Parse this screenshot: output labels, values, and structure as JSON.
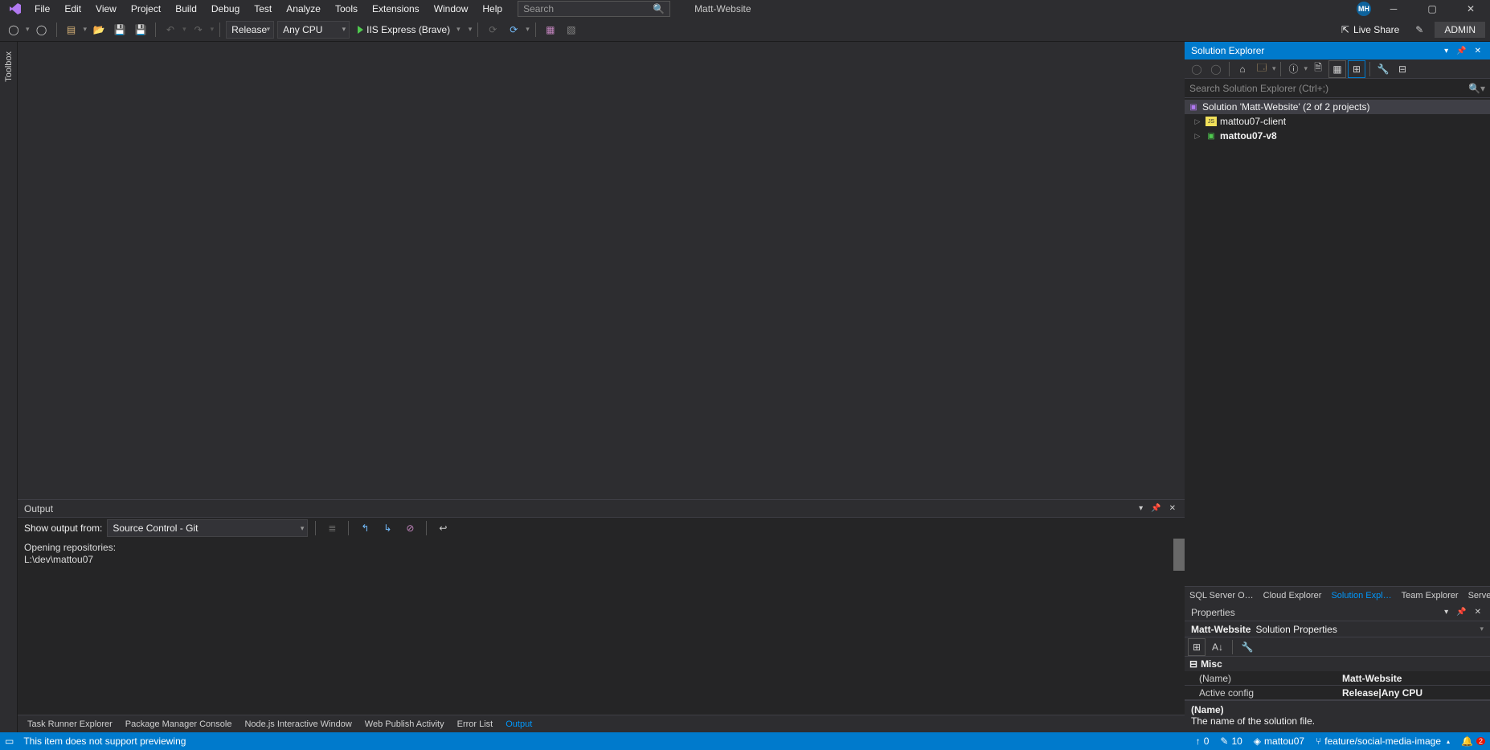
{
  "menu": [
    "File",
    "Edit",
    "View",
    "Project",
    "Build",
    "Debug",
    "Test",
    "Analyze",
    "Tools",
    "Extensions",
    "Window",
    "Help"
  ],
  "search_placeholder": "Search",
  "solution_name_title": "Matt-Website",
  "avatar_initials": "MH",
  "toolbar": {
    "config": "Release",
    "platform": "Any CPU",
    "run_target": "IIS Express (Brave)",
    "live_share": "Live Share",
    "admin": "ADMIN"
  },
  "left_rail": {
    "toolbox": "Toolbox"
  },
  "output": {
    "title": "Output",
    "show_from_label": "Show output from:",
    "show_from_value": "Source Control - Git",
    "body": "Opening repositories:\nL:\\dev\\mattou07"
  },
  "bottom_tabs": [
    "Task Runner Explorer",
    "Package Manager Console",
    "Node.js Interactive Window",
    "Web Publish Activity",
    "Error List",
    "Output"
  ],
  "bottom_active": "Output",
  "solution_explorer": {
    "title": "Solution Explorer",
    "search_placeholder": "Search Solution Explorer (Ctrl+;)",
    "root": "Solution 'Matt-Website' (2 of 2 projects)",
    "projects": [
      {
        "name": "mattou07-client",
        "bold": false,
        "badge": "JS"
      },
      {
        "name": "mattou07-v8",
        "bold": true,
        "badge": "C#"
      }
    ],
    "tabs": [
      "SQL Server O…",
      "Cloud Explorer",
      "Solution Expl…",
      "Team Explorer",
      "Server Explorer"
    ],
    "active_tab": "Solution Expl…"
  },
  "properties": {
    "title": "Properties",
    "object": "Matt-Website",
    "object_type": "Solution Properties",
    "category": "Misc",
    "rows": [
      {
        "name": "(Name)",
        "value": "Matt-Website"
      },
      {
        "name": "Active config",
        "value": "Release|Any CPU"
      }
    ],
    "desc_name": "(Name)",
    "desc_text": "The name of the solution file."
  },
  "statusbar": {
    "preview_msg": "This item does not support previewing",
    "up": "0",
    "pencil": "10",
    "user": "mattou07",
    "branch": "feature/social-media-image",
    "notif": "2"
  }
}
